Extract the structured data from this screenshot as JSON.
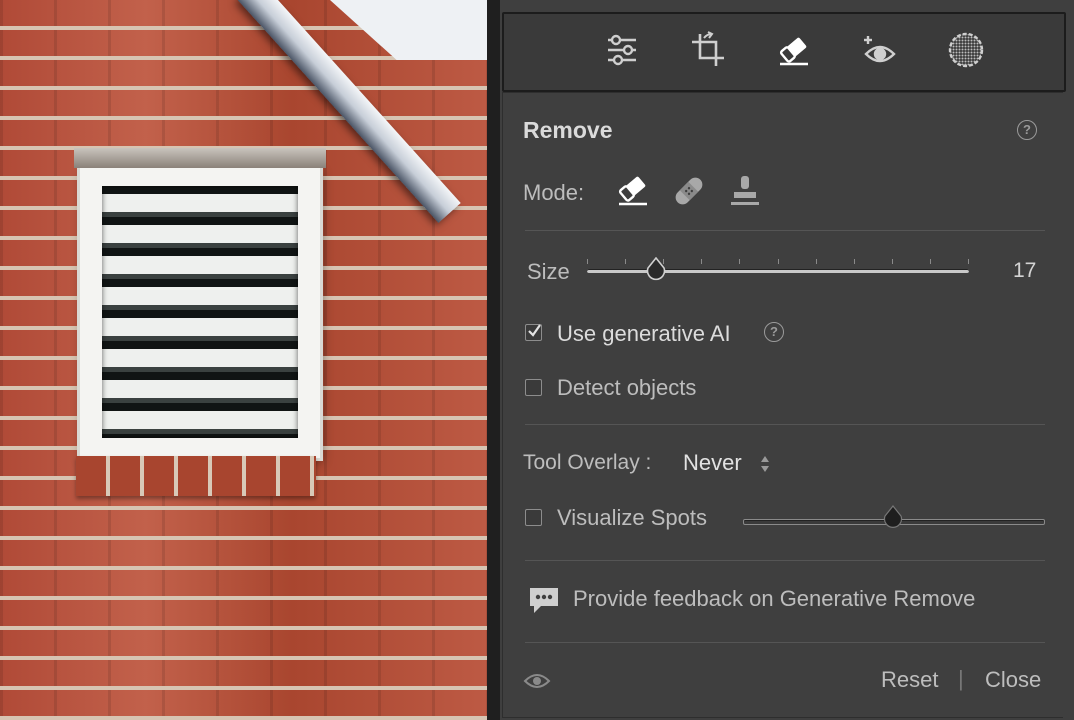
{
  "toolbar": {
    "tools": [
      {
        "icon": "edit-sliders-icon"
      },
      {
        "icon": "crop-icon"
      },
      {
        "icon": "remove-eraser-icon",
        "active": true
      },
      {
        "icon": "red-eye-icon"
      },
      {
        "icon": "masking-icon"
      }
    ]
  },
  "remove": {
    "title": "Remove",
    "mode_label": "Mode:",
    "modes": [
      {
        "icon": "remove-mode-icon",
        "active": true
      },
      {
        "icon": "heal-mode-icon"
      },
      {
        "icon": "clone-mode-icon"
      }
    ],
    "size_label": "Size",
    "size_value": "17",
    "size_fraction": 0.18,
    "use_generative_ai": {
      "label": "Use generative AI",
      "checked": true
    },
    "detect_objects": {
      "label": "Detect objects",
      "checked": false
    },
    "tool_overlay": {
      "label": "Tool Overlay :",
      "value": "Never"
    },
    "visualize_spots": {
      "label": "Visualize Spots",
      "checked": false,
      "fraction": 0.5
    },
    "feedback_label": "Provide feedback on Generative Remove",
    "reset_label": "Reset",
    "separator": "|",
    "close_label": "Close"
  },
  "colors": {
    "panel_bg": "#3f3f3f",
    "toolstrip_bg": "#3a3a3a",
    "text": "#d4d4d4",
    "muted_text": "#bdbdbd"
  }
}
